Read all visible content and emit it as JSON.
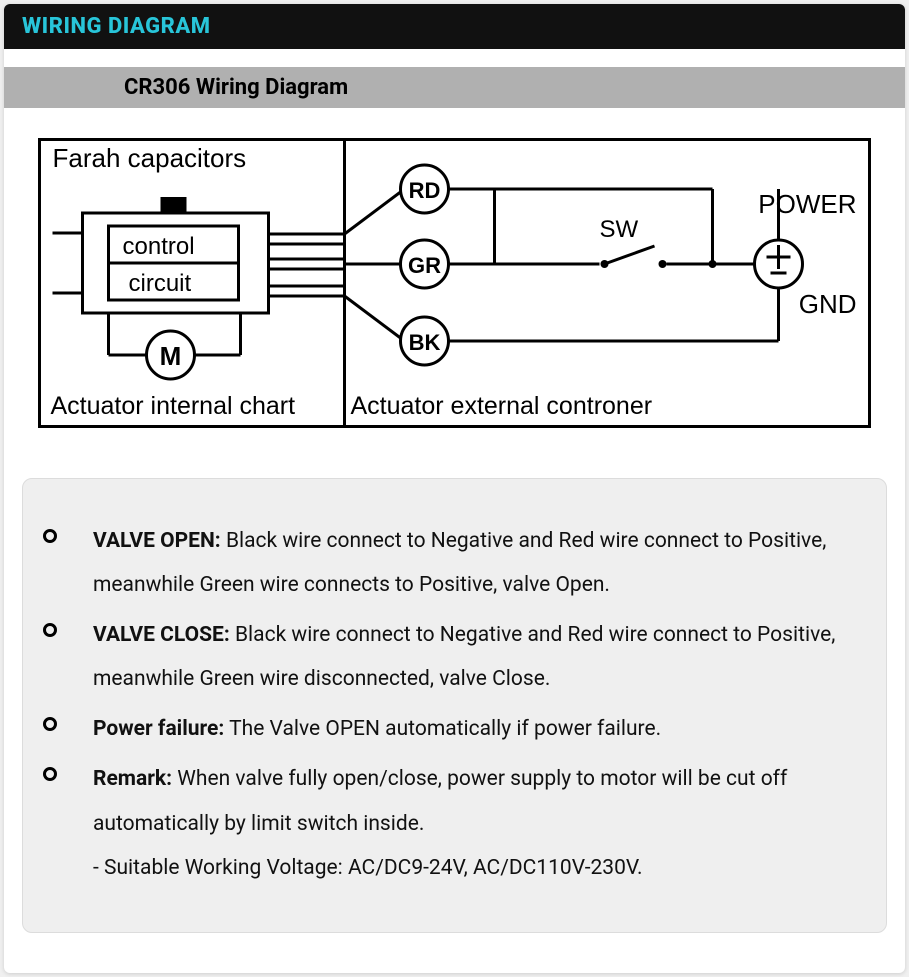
{
  "header": {
    "title": "WIRING DIAGRAM"
  },
  "subheader": {
    "title": "CR306 Wiring Diagram"
  },
  "diagram": {
    "cap_label": "Farah capacitors",
    "ctrl_line1": "control",
    "ctrl_line2": "circuit",
    "motor": "M",
    "term_rd": "RD",
    "term_gr": "GR",
    "term_bk": "BK",
    "sw": "SW",
    "power": "POWER",
    "gnd": "GND",
    "left_caption": "Actuator internal chart",
    "right_caption": "Actuator external controner"
  },
  "notes": {
    "items": [
      {
        "label": "VALVE OPEN:",
        "text": " Black wire connect to Negative and Red wire connect to Positive, meanwhile Green wire connects to Positive, valve Open."
      },
      {
        "label": "VALVE CLOSE:",
        "text": " Black wire connect to Negative and Red wire connect to Positive, meanwhile Green wire disconnected, valve Close."
      },
      {
        "label": "Power failure:",
        "text": " The Valve OPEN automatically if power failure."
      },
      {
        "label": "Remark:",
        "text": " When valve fully open/close, power supply to motor will be cut off automatically by limit switch inside."
      }
    ],
    "footer": "- Suitable Working Voltage: AC/DC9-24V, AC/DC110V-230V."
  }
}
